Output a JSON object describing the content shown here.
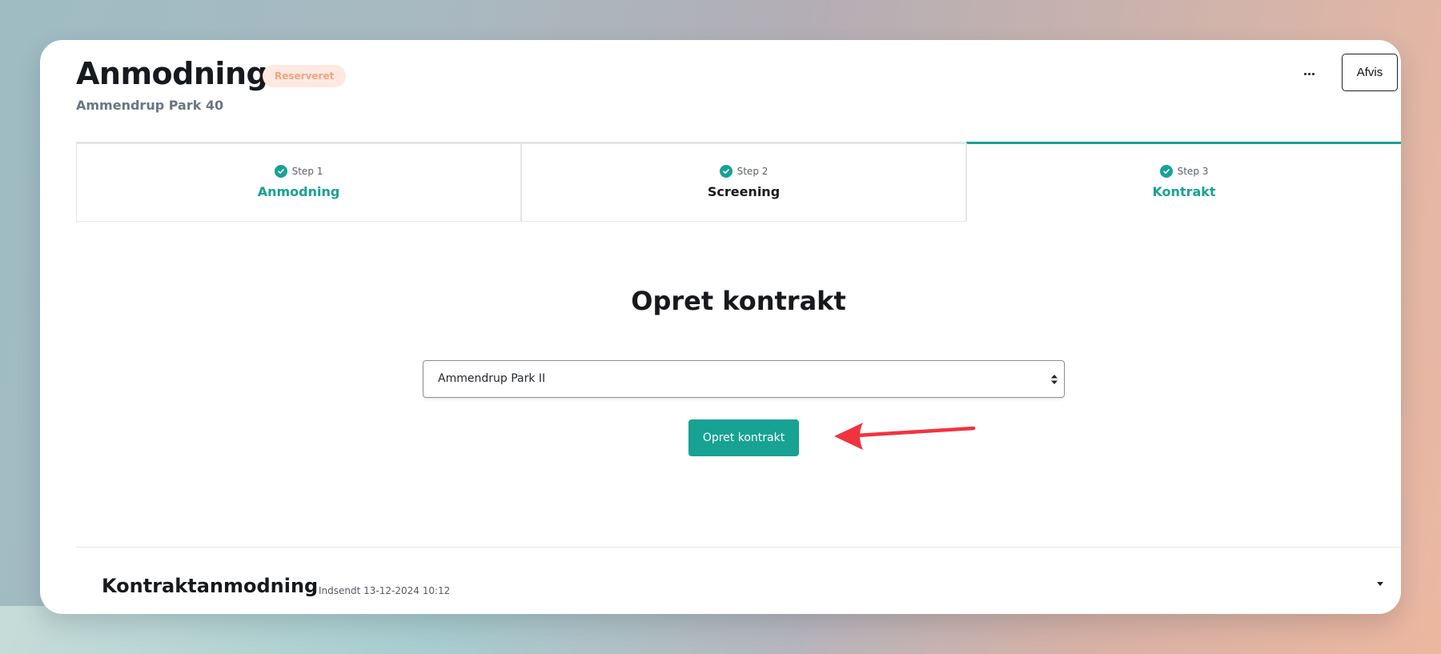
{
  "header": {
    "title": "Anmodning",
    "status_badge": "Reserveret",
    "subtitle": "Ammendrup Park 40",
    "more_icon": "ellipsis-horizontal-icon",
    "reject_label": "Afvis"
  },
  "steps": [
    {
      "number": "Step 1",
      "label": "Anmodning",
      "completed": true,
      "active": false
    },
    {
      "number": "Step 2",
      "label": "Screening",
      "completed": true,
      "active": false
    },
    {
      "number": "Step 3",
      "label": "Kontrakt",
      "completed": true,
      "active": true
    }
  ],
  "contract": {
    "title": "Opret kontrakt",
    "select_value": "Ammendrup Park II",
    "create_label": "Opret kontrakt"
  },
  "section": {
    "title": "Kontraktanmodning",
    "submitted": "Indsendt 13-12-2024 10:12"
  },
  "colors": {
    "accent": "#17a294",
    "badge_bg": "#fde9e2",
    "badge_text": "#f2a482",
    "annotation_arrow": "#f2333f"
  }
}
